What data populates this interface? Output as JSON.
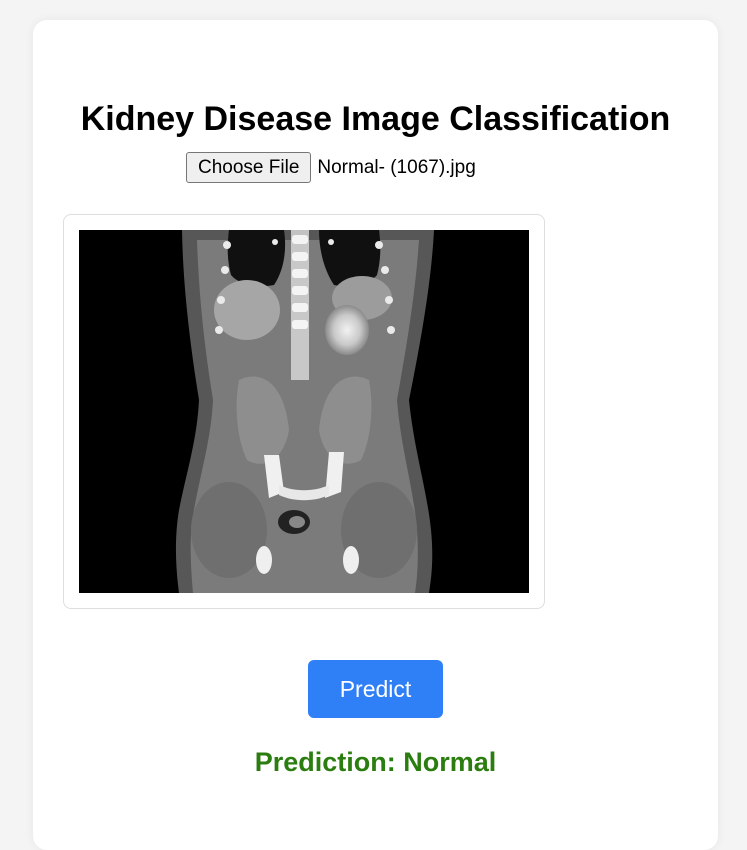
{
  "header": {
    "title": "Kidney Disease Image Classification"
  },
  "file_input": {
    "button_label": "Choose File",
    "file_name": "Normal- (1067).jpg"
  },
  "preview": {
    "icon": "ct-scan-image"
  },
  "actions": {
    "predict_label": "Predict"
  },
  "result": {
    "text": "Prediction: Normal",
    "color": "#2b7d0f"
  },
  "colors": {
    "accent": "#2f7ff7",
    "background": "#f4f4f4",
    "card": "#ffffff"
  }
}
